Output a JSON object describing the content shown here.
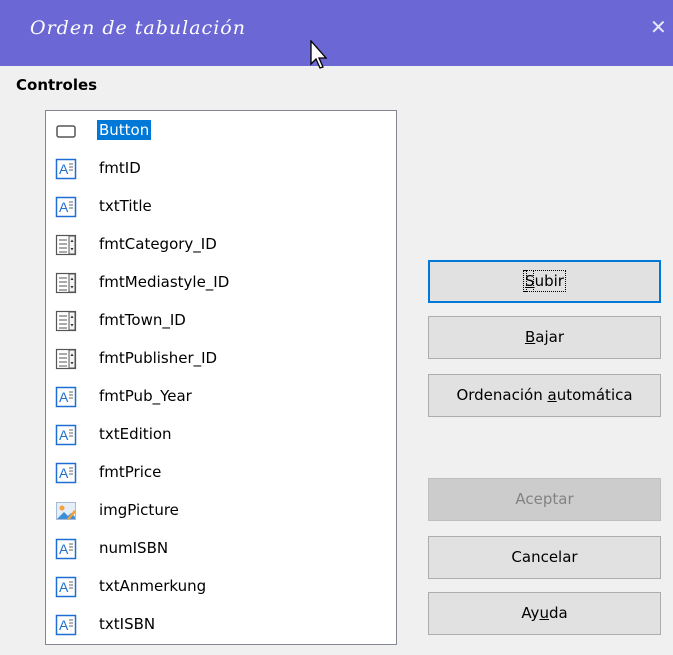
{
  "dialog": {
    "title": "Orden de tabulación",
    "controls_label": "Controles"
  },
  "controls": [
    {
      "label": "Button",
      "icon": "push-button-icon",
      "selected": true
    },
    {
      "label": "fmtID",
      "icon": "text-field-icon"
    },
    {
      "label": "txtTitle",
      "icon": "text-field-icon"
    },
    {
      "label": "fmtCategory_ID",
      "icon": "listbox-icon"
    },
    {
      "label": "fmtMediastyle_ID",
      "icon": "listbox-icon"
    },
    {
      "label": "fmtTown_ID",
      "icon": "listbox-icon"
    },
    {
      "label": "fmtPublisher_ID",
      "icon": "listbox-icon"
    },
    {
      "label": "fmtPub_Year",
      "icon": "text-field-icon"
    },
    {
      "label": "txtEdition",
      "icon": "text-field-icon"
    },
    {
      "label": "fmtPrice",
      "icon": "text-field-icon"
    },
    {
      "label": "imgPicture",
      "icon": "image-control-icon"
    },
    {
      "label": "numISBN",
      "icon": "text-field-icon"
    },
    {
      "label": "txtAnmerkung",
      "icon": "text-field-icon"
    },
    {
      "label": "txtISBN",
      "icon": "text-field-icon"
    }
  ],
  "buttons": {
    "up": {
      "pre": "",
      "mn": "S",
      "post": "ubir"
    },
    "down": {
      "pre": "",
      "mn": "B",
      "post": "ajar"
    },
    "auto": {
      "pre": "Ordenación ",
      "mn": "a",
      "post": "utomática"
    },
    "ok": {
      "pre": "Aceptar",
      "mn": "",
      "post": ""
    },
    "cancel": {
      "pre": "Cancelar",
      "mn": "",
      "post": ""
    },
    "help": {
      "pre": "Ay",
      "mn": "u",
      "post": "da"
    }
  }
}
